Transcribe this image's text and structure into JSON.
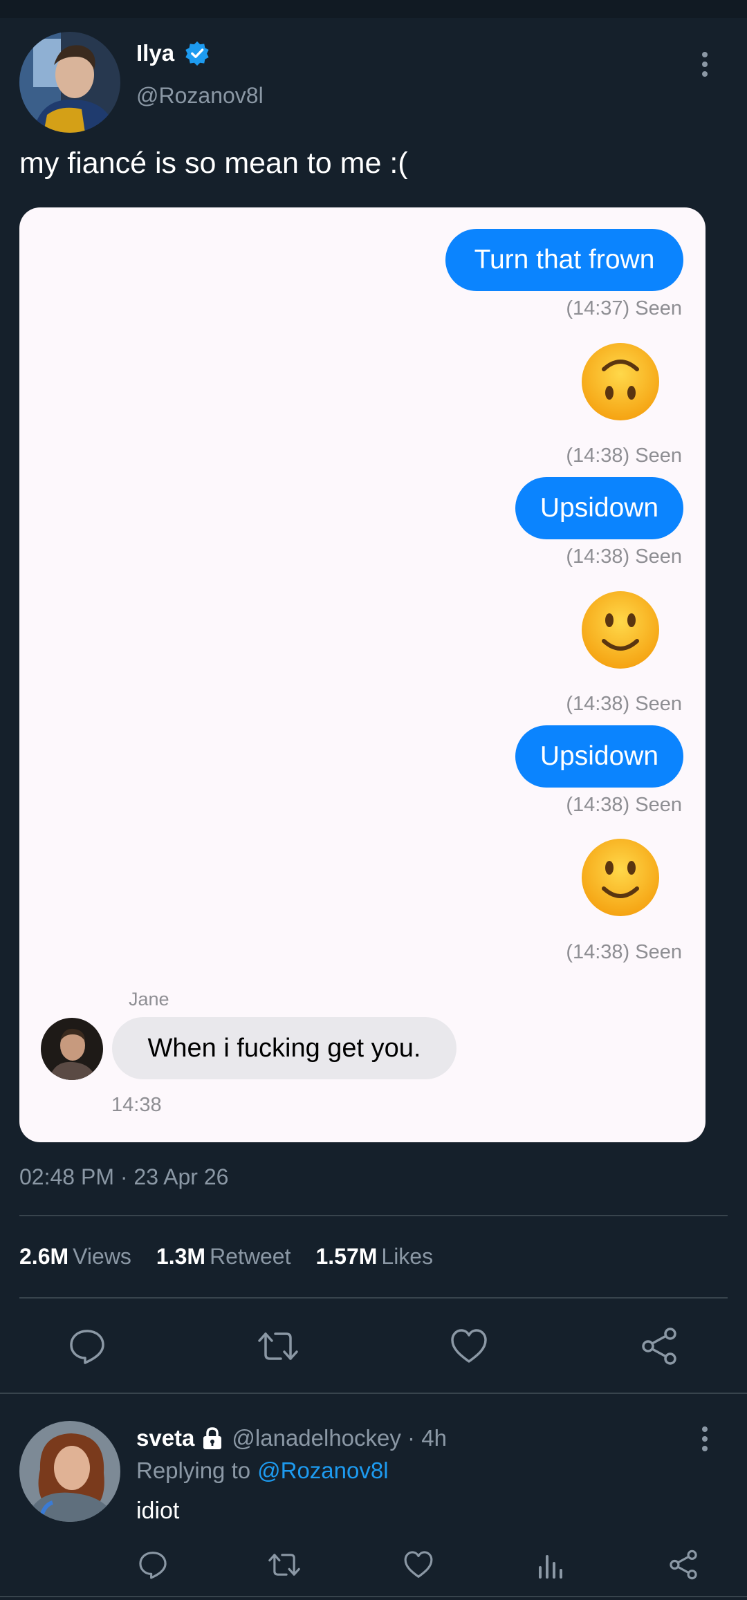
{
  "tweet": {
    "author": {
      "name": "Ilya",
      "handle": "@Rozanov8l",
      "verified": true
    },
    "text": "my fiancé is so mean to me :(",
    "screenshot": {
      "messages": [
        {
          "type": "text",
          "text": "Turn that frown",
          "status": "(14:37) Seen"
        },
        {
          "type": "emoji",
          "emoji": "upside-down-face",
          "status": "(14:38) Seen"
        },
        {
          "type": "text",
          "text": "Upsidown",
          "status": "(14:38) Seen"
        },
        {
          "type": "emoji",
          "emoji": "slightly-smiling-face",
          "status": "(14:38) Seen"
        },
        {
          "type": "text",
          "text": "Upsidown",
          "status": "(14:38) Seen"
        },
        {
          "type": "emoji",
          "emoji": "slightly-smiling-face",
          "status": "(14:38) Seen"
        }
      ],
      "incoming": {
        "sender": "Jane",
        "text": "When i fucking get you.",
        "time": "14:38"
      }
    },
    "timestamp": "02:48 PM · 23 Apr 26",
    "stats": {
      "views_count": "2.6M",
      "views_label": "Views",
      "retweets_count": "1.3M",
      "retweets_label": "Retweet",
      "likes_count": "1.57M",
      "likes_label": "Likes"
    },
    "actions": [
      "reply-icon",
      "retweet-icon",
      "like-icon",
      "share-icon"
    ]
  },
  "reply": {
    "name": "sveta",
    "handle_time": "@lanadelhockey · 4h",
    "replying_label": "Replying to",
    "replying_to": "@Rozanov8l",
    "text": "idiot",
    "actions": [
      "reply-icon",
      "retweet-icon",
      "like-icon",
      "analytics-icon",
      "share-icon"
    ]
  },
  "colors": {
    "background": "#15202b",
    "accent": "#1d9bf0",
    "imessage_blue": "#0b84fe",
    "muted": "#8b98a5"
  }
}
